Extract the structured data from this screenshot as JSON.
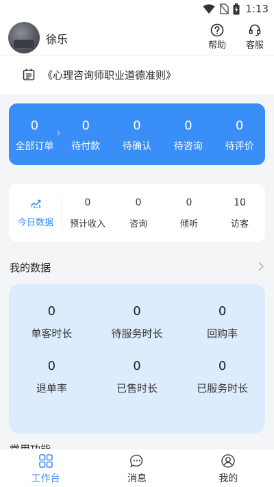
{
  "status_bar": {
    "time": "1:13",
    "icons": [
      "wifi-icon",
      "no-sim-icon",
      "battery-charging-icon"
    ]
  },
  "header": {
    "username": "徐乐",
    "help_label": "帮助",
    "service_label": "客服"
  },
  "notice": {
    "text": "《心理咨询师职业道德准则》"
  },
  "orders": [
    {
      "count": "0",
      "label": "全部订单"
    },
    {
      "count": "0",
      "label": "待付款"
    },
    {
      "count": "0",
      "label": "待确认"
    },
    {
      "count": "0",
      "label": "待咨询"
    },
    {
      "count": "0",
      "label": "待评价"
    }
  ],
  "today": {
    "tab_label": "今日数据",
    "items": [
      {
        "count": "0",
        "label": "预计收入"
      },
      {
        "count": "0",
        "label": "咨询"
      },
      {
        "count": "0",
        "label": "倾听"
      },
      {
        "count": "10",
        "label": "访客"
      }
    ]
  },
  "my_data": {
    "title": "我的数据",
    "items": [
      {
        "value": "0",
        "label": "单客时长"
      },
      {
        "value": "0",
        "label": "待服务时长"
      },
      {
        "value": "0",
        "label": "回购率"
      },
      {
        "value": "0",
        "label": "退单率"
      },
      {
        "value": "0",
        "label": "已售时长"
      },
      {
        "value": "0",
        "label": "已服务时长"
      }
    ]
  },
  "next_section_peek": "常用功能",
  "tabs": [
    {
      "label": "工作台",
      "icon": "grid-icon",
      "active": true
    },
    {
      "label": "消息",
      "icon": "message-icon",
      "active": false
    },
    {
      "label": "我的",
      "icon": "user-icon",
      "active": false
    }
  ],
  "colors": {
    "accent": "#3a8ef7",
    "card_light_blue": "#dcecfd",
    "background": "#f4f5f7"
  }
}
